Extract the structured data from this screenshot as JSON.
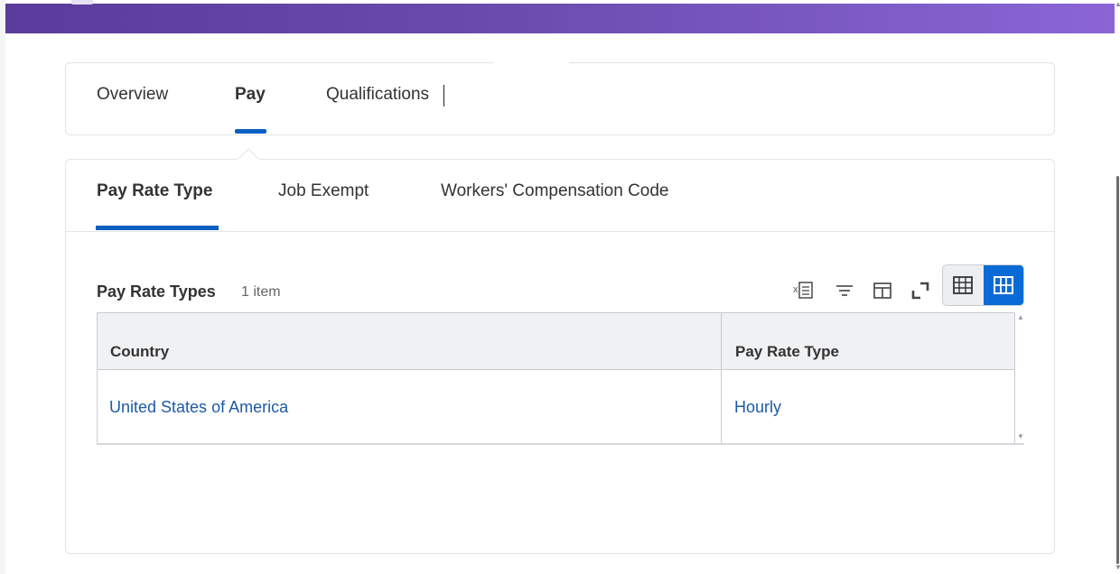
{
  "main_tabs": [
    {
      "label": "Overview",
      "active": false
    },
    {
      "label": "Pay",
      "active": true
    },
    {
      "label": "Qualifications",
      "active": false
    }
  ],
  "sub_tabs": [
    {
      "label": "Pay Rate Type",
      "active": true
    },
    {
      "label": "Job Exempt",
      "active": false
    },
    {
      "label": "Workers' Compensation Code",
      "active": false
    }
  ],
  "grid": {
    "title": "Pay Rate Types",
    "count": "1 item",
    "toolbar": {
      "icons": [
        "export-to-excel-icon",
        "filter-icon",
        "column-layout-icon",
        "fullscreen-icon",
        "table-view-icon",
        "grid-view-icon"
      ]
    },
    "columns": [
      "Country",
      "Pay Rate Type"
    ],
    "rows": [
      [
        "United States of America",
        "Hourly"
      ]
    ]
  },
  "colors": {
    "banner_start": "#5b3b9b",
    "banner_end": "#8b65d6",
    "accent": "#0b5fc1",
    "link": "#1c5aa6"
  }
}
